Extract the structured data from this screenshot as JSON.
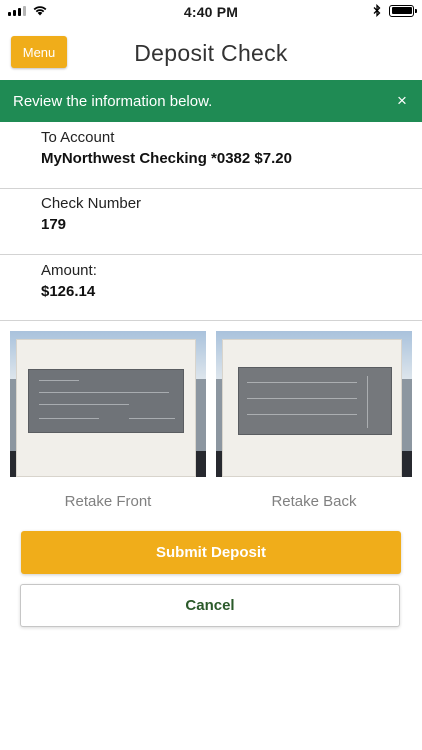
{
  "status_bar": {
    "time": "4:40 PM",
    "icons": [
      "cellular-signal-icon",
      "wifi-icon",
      "bluetooth-icon",
      "battery-icon"
    ]
  },
  "header": {
    "menu_label": "Menu",
    "title": "Deposit Check"
  },
  "banner": {
    "message": "Review the information below.",
    "close_symbol": "×",
    "color": "#1f8b54"
  },
  "details": {
    "to_account": {
      "label": "To Account",
      "value": "MyNorthwest Checking *0382 $7.20"
    },
    "check_number": {
      "label": "Check Number",
      "value": "179"
    },
    "amount": {
      "label": "Amount:",
      "value": "$126.14"
    }
  },
  "images": {
    "front": {
      "retake_label": "Retake Front"
    },
    "back": {
      "retake_label": "Retake Back"
    }
  },
  "actions": {
    "submit_label": "Submit Deposit",
    "cancel_label": "Cancel"
  },
  "colors": {
    "accent": "#f0ad1a",
    "success_banner": "#1f8b54",
    "cancel_text": "#2b5a2a"
  }
}
